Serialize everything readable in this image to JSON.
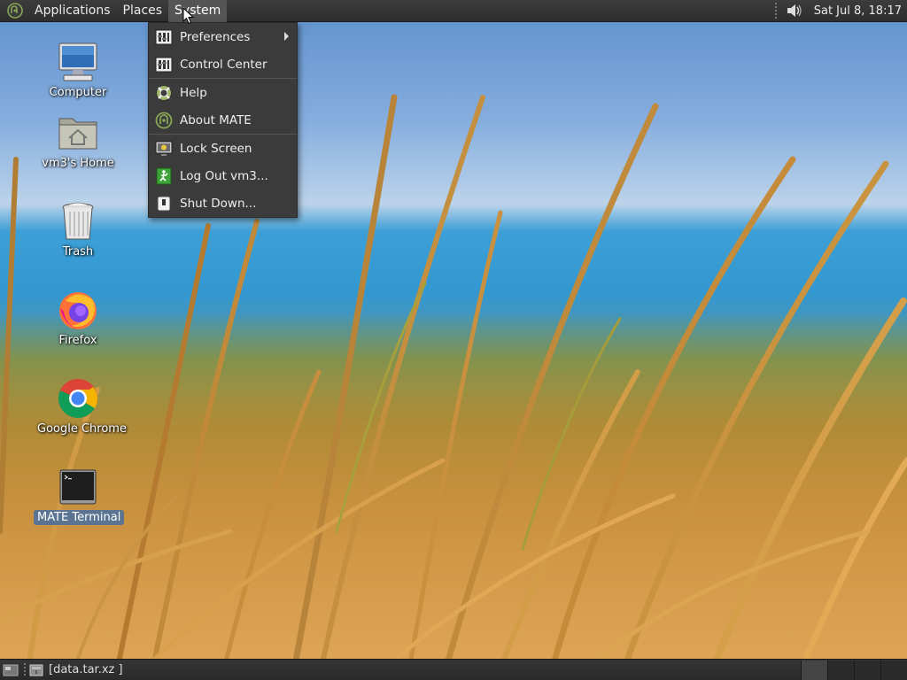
{
  "top_panel": {
    "menus": {
      "applications": "Applications",
      "places": "Places",
      "system": "System"
    },
    "volume_icon": "speaker-icon",
    "clock": "Sat Jul  8, 18:17"
  },
  "system_menu": {
    "items": [
      {
        "label": "Preferences",
        "icon": "preferences-icon",
        "has_submenu": true
      },
      {
        "label": "Control Center",
        "icon": "control-center-icon"
      },
      {
        "label": "Help",
        "icon": "help-lifebuoy-icon"
      },
      {
        "label": "About MATE",
        "icon": "mate-logo-icon"
      },
      {
        "label": "Lock Screen",
        "icon": "lock-screen-icon"
      },
      {
        "label": "Log Out vm3...",
        "icon": "logout-icon"
      },
      {
        "label": "Shut Down...",
        "icon": "shutdown-icon"
      }
    ]
  },
  "desktop": {
    "icons": [
      {
        "label": "Computer",
        "icon": "computer-icon"
      },
      {
        "label": "vm3's Home",
        "icon": "home-folder-icon"
      },
      {
        "label": "Trash",
        "icon": "trash-icon"
      },
      {
        "label": "Firefox",
        "icon": "firefox-icon"
      },
      {
        "label": "Google Chrome",
        "icon": "chrome-icon"
      },
      {
        "label": "MATE Terminal",
        "icon": "terminal-icon",
        "selected": true
      }
    ]
  },
  "bottom_panel": {
    "task": "[data.tar.xz ]",
    "workspaces": 4,
    "active_workspace": 1
  },
  "colors": {
    "panel": "#2e2e2e",
    "menu": "#3b3b3b",
    "selection": "#466ea0"
  }
}
